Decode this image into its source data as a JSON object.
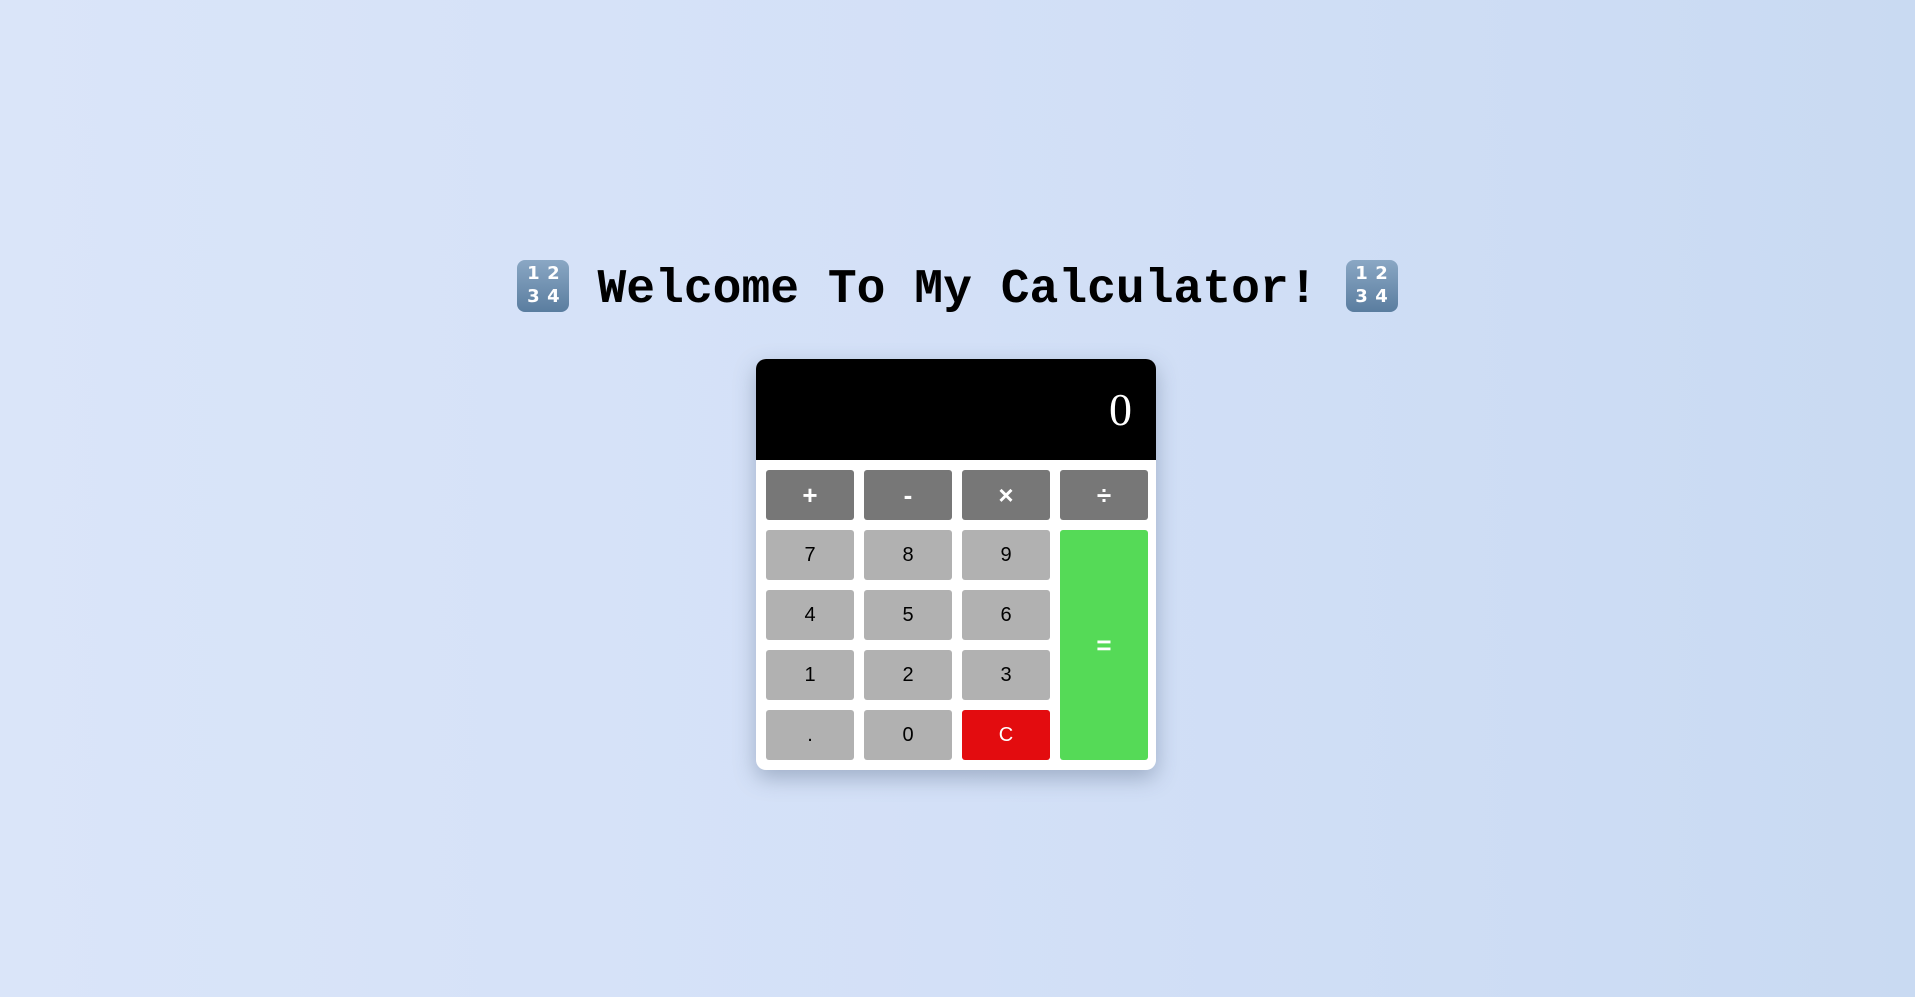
{
  "header": {
    "icon_left": "input-numbers-icon",
    "icon_right": "input-numbers-icon",
    "icon_digits": [
      "1",
      "2",
      "3",
      "4"
    ],
    "title": "Welcome To My Calculator!"
  },
  "calculator": {
    "display_value": "0",
    "operators": {
      "add": "+",
      "subtract": "-",
      "multiply": "×",
      "divide": "÷"
    },
    "digits": {
      "seven": "7",
      "eight": "8",
      "nine": "9",
      "four": "4",
      "five": "5",
      "six": "6",
      "one": "1",
      "two": "2",
      "three": "3",
      "zero": "0"
    },
    "decimal": ".",
    "clear": "C",
    "equals": "="
  },
  "colors": {
    "display_bg": "#000000",
    "operator_key": "#777777",
    "digit_key": "#b1b1b1",
    "clear_key": "#e30c0f",
    "equals_key": "#55da57"
  }
}
